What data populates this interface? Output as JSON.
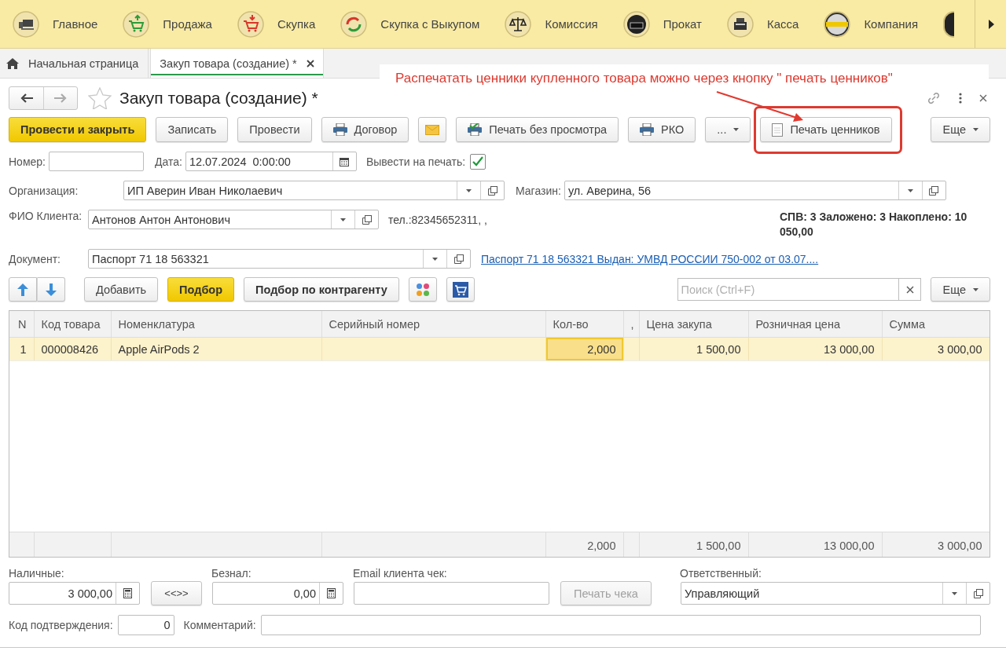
{
  "nav": [
    {
      "kind": "computer",
      "label": "Главное"
    },
    {
      "kind": "sale",
      "label": "Продажа"
    },
    {
      "kind": "buy",
      "label": "Скупка"
    },
    {
      "kind": "buyback",
      "label": "Скупка с Выкупом"
    },
    {
      "kind": "commission",
      "label": "Комиссия"
    },
    {
      "kind": "rent",
      "label": "Прокат"
    },
    {
      "kind": "cash",
      "label": "Касса"
    },
    {
      "kind": "company",
      "label": "Компания"
    },
    {
      "kind": "partial"
    }
  ],
  "tabs": [
    {
      "kind": "home",
      "label": "Начальная страница",
      "selected": false
    },
    {
      "kind": "document",
      "label": "Закуп товара (создание) *",
      "selected": true
    }
  ],
  "annotation": {
    "text": "Распечатать ценники купленного товара можно через кнопку \" печать ценников\""
  },
  "document": {
    "title": "Закуп товара (создание) *"
  },
  "commands": [
    {
      "kind": "primary",
      "label": "Провести и закрыть"
    },
    {
      "kind": "plain",
      "label": "Записать"
    },
    {
      "kind": "plain",
      "label": "Провести"
    },
    {
      "kind": "print",
      "label": "Договор"
    },
    {
      "kind": "mail"
    },
    {
      "kind": "print-direct",
      "label": "Печать без просмотра"
    },
    {
      "kind": "print",
      "label": "РКО"
    },
    {
      "kind": "menu",
      "label": "..."
    },
    {
      "kind": "sheet",
      "label": "Печать ценников"
    },
    {
      "kind": "more",
      "label": "Еще"
    }
  ],
  "number": {
    "label": "Номер:"
  },
  "date": {
    "label": "Дата:",
    "value": "12.07.2024  0:00:00"
  },
  "print_flag": {
    "label": "Вывести на печать:",
    "checked": true
  },
  "organization": {
    "label": "Организация:",
    "value": "ИП Аверин Иван Николаевич"
  },
  "store": {
    "label": "Магазин:",
    "value": "ул. Аверина, 56"
  },
  "client": {
    "label": "ФИО Клиента:",
    "value": "Антонов Антон Антонович",
    "phone": "тел.:82345652311, ,"
  },
  "stats": "СПВ: 3 Заложено: 3 Накоплено: 10 050,00",
  "id_document": {
    "label": "Документ:",
    "value": "Паспорт 71 18 563321",
    "link": "Паспорт 71 18 563321 Выдан: УМВД РОССИИ 750-002 от 03.07...."
  },
  "table_toolbar": {
    "buttons": [
      {
        "kind": "move-up"
      },
      {
        "kind": "move-down"
      },
      {
        "kind": "plain",
        "label": "Добавить"
      },
      {
        "kind": "primary",
        "label": "Подбор"
      },
      {
        "kind": "bold",
        "label": "Подбор по контрагенту"
      },
      {
        "kind": "palette"
      },
      {
        "kind": "cart"
      }
    ],
    "search_placeholder": "Поиск (Ctrl+F)",
    "more": "Еще"
  },
  "table": {
    "columns": [
      {
        "title": "N",
        "kind": "number"
      },
      {
        "title": "Код товара",
        "kind": "text"
      },
      {
        "title": "Номенклатура",
        "kind": "text"
      },
      {
        "title": "Серийный номер",
        "kind": "text"
      },
      {
        "title": "Кол-во",
        "kind": "number",
        "total": "2,000"
      },
      {
        "title": ",",
        "kind": "text"
      },
      {
        "title": "Цена закупа",
        "kind": "number",
        "total": "1 500,00"
      },
      {
        "title": "Розничная цена",
        "kind": "number",
        "total": "13 000,00"
      },
      {
        "title": "Сумма",
        "kind": "number",
        "total": "3 000,00"
      }
    ],
    "rows": [
      {
        "selected": true,
        "cells": [
          {
            "text": "1",
            "active": false
          },
          {
            "text": "000008426",
            "active": false
          },
          {
            "text": "Apple AirPods 2",
            "active": false
          },
          {
            "active": false
          },
          {
            "text": "2,000",
            "active": true
          },
          {
            "active": false
          },
          {
            "text": "1 500,00",
            "active": false
          },
          {
            "text": "13 000,00",
            "active": false
          },
          {
            "text": "3 000,00",
            "active": false
          }
        ]
      }
    ]
  },
  "cash": {
    "label": "Наличные:",
    "value": "3 000,00"
  },
  "swap_button": "<<>>",
  "cashless": {
    "label": "Безнал:",
    "value": "0,00"
  },
  "email": {
    "label": "Email клиента чек:"
  },
  "receipt_button": {
    "label": "Печать чека",
    "disabled": true
  },
  "responsible": {
    "label": "Ответственный:",
    "value": "Управляющий"
  },
  "confirm_code": {
    "label": "Код подтверждения:",
    "value": "0"
  },
  "comment": {
    "label": "Комментарий:"
  }
}
